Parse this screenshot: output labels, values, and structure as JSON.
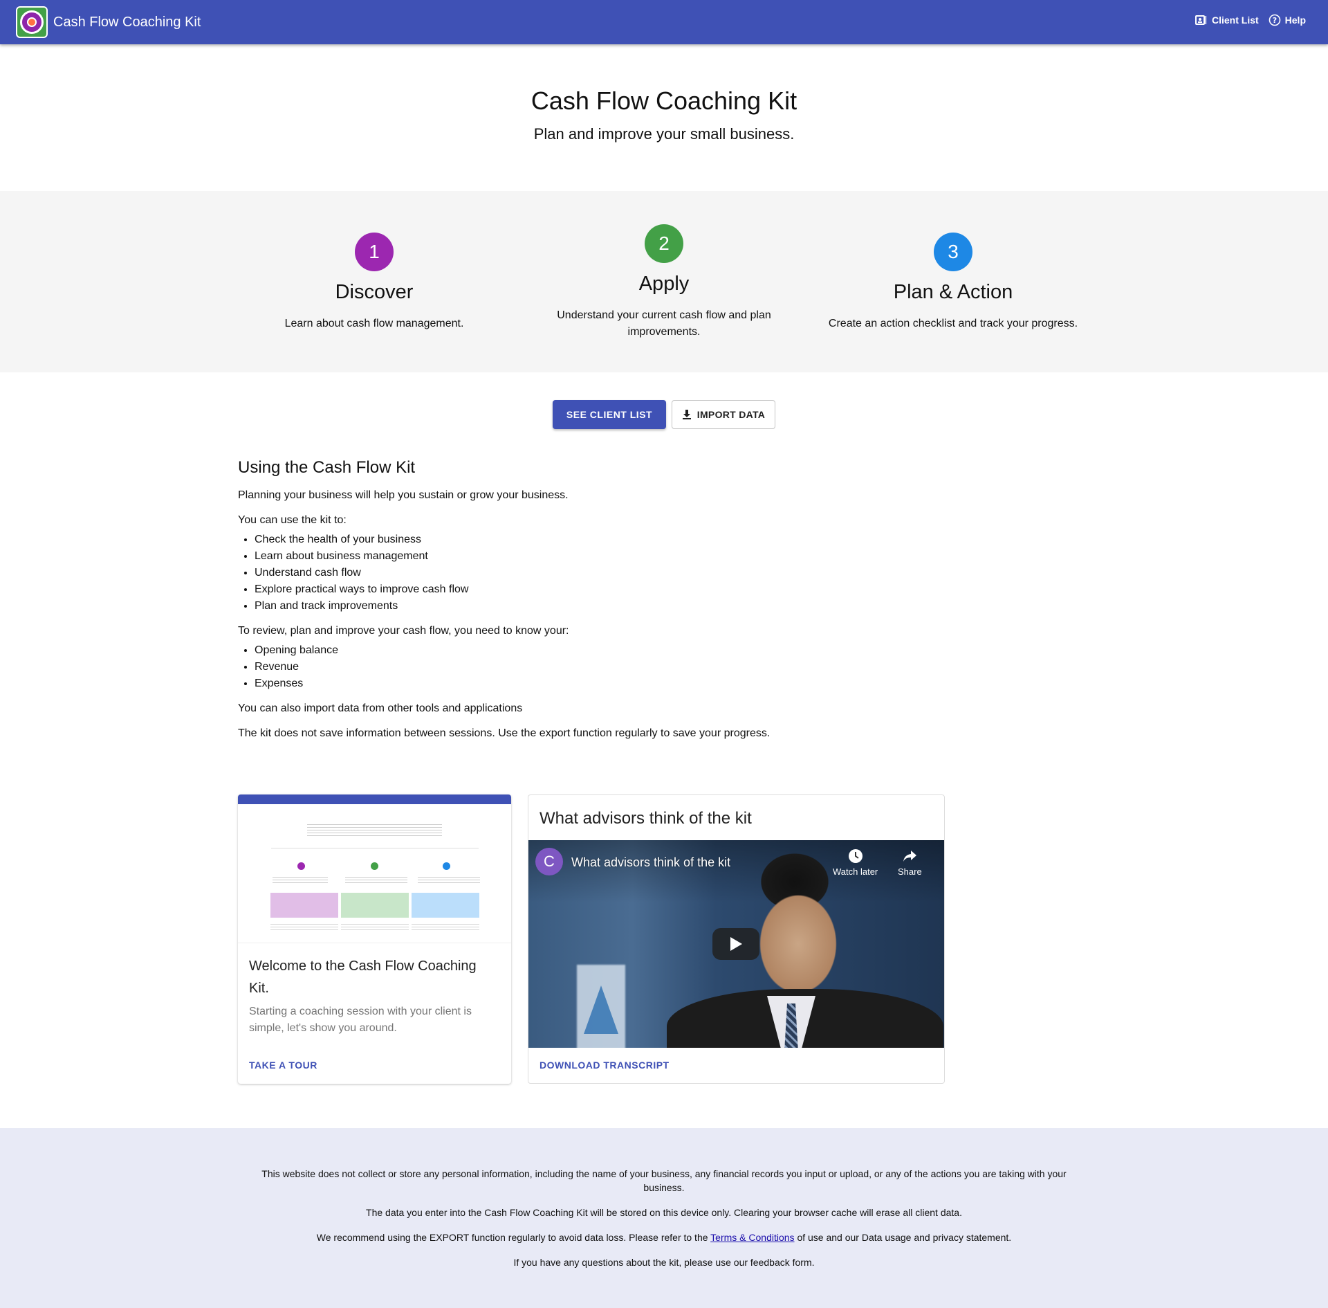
{
  "app": {
    "title": "Cash Flow Coaching Kit",
    "nav": {
      "client_list": "Client List",
      "help": "Help"
    }
  },
  "hero": {
    "title": "Cash Flow Coaching Kit",
    "subtitle": "Plan and improve your small business."
  },
  "steps": [
    {
      "number": "1",
      "title": "Discover",
      "description": "Learn about cash flow management.",
      "color": "#9c27b0"
    },
    {
      "number": "2",
      "title": "Apply",
      "description": "Understand your current cash flow and plan improvements.",
      "color": "#43a047"
    },
    {
      "number": "3",
      "title": "Plan & Action",
      "description": "Create an action checklist and track your progress.",
      "color": "#1e88e5"
    }
  ],
  "actions": {
    "see_client_list": "SEE CLIENT LIST",
    "import_data": "IMPORT DATA"
  },
  "content": {
    "heading": "Using the Cash Flow Kit",
    "intro": "Planning your business will help you sustain or grow your business.",
    "use_label": "You can use the kit to:",
    "uses": [
      "Check the health of your business",
      "Learn about business management",
      "Understand cash flow",
      "Explore practical ways to improve cash flow",
      "Plan and track improvements"
    ],
    "need_label": "To review, plan and improve your cash flow, you need to know your:",
    "needs": [
      "Opening balance",
      "Revenue",
      "Expenses"
    ],
    "import_note": "You can also import data from other tools and applications",
    "save_note": "The kit does not save information between sessions. Use the export function regularly to save your progress."
  },
  "tour_card": {
    "heading": "Welcome to the Cash Flow Coaching Kit.",
    "body": "Starting a coaching session with your client is simple, let's show you around.",
    "link": "TAKE A TOUR"
  },
  "video_card": {
    "heading": "What advisors think of the kit",
    "channel_initial": "C",
    "video_title": "What advisors think of the kit",
    "watch_later": "Watch later",
    "share": "Share",
    "link": "DOWNLOAD TRANSCRIPT"
  },
  "footer": {
    "privacy": "This website does not collect or store any personal information, including the name of your business, any financial records you input or upload, or any of the actions you are taking with your business.",
    "storage": "The data you enter into the Cash Flow Coaching Kit will be stored on this device only. Clearing your browser cache will erase all client data.",
    "export_before": "We recommend using the EXPORT function regularly to avoid data loss. Please refer to the ",
    "terms_link": "Terms & Conditions",
    "export_after": " of use and our Data usage and privacy statement.",
    "feedback": "If you have any questions about the kit, please use our feedback form."
  },
  "colors": {
    "primary": "#3f51b5",
    "footer_bg": "#e8eaf6",
    "band_bg": "#f5f5f5"
  }
}
